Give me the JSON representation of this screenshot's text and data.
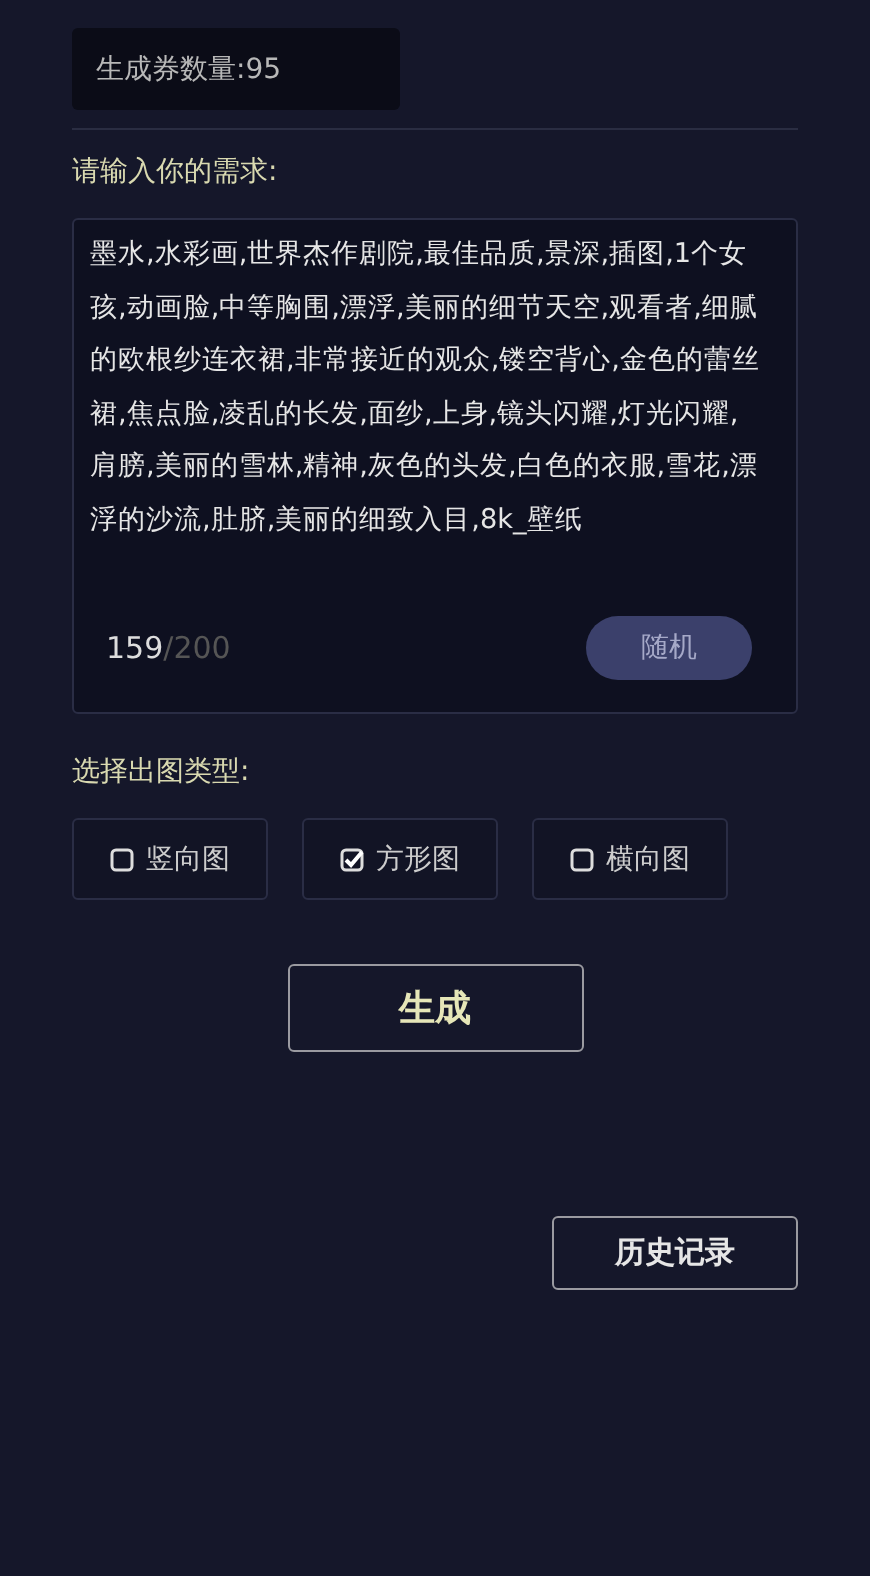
{
  "quota": {
    "text": "生成券数量:95"
  },
  "prompt": {
    "label": "请输入你的需求:",
    "value": "墨水,水彩画,世界杰作剧院,最佳品质,景深,插图,1个女孩,动画脸,中等胸围,漂浮,美丽的细节天空,观看者,细腻的欧根纱连衣裙,非常接近的观众,镂空背心,金色的蕾丝裙,焦点脸,凌乱的长发,面纱,上身,镜头闪耀,灯光闪耀,肩膀,美丽的雪林,精神,灰色的头发,白色的衣服,雪花,漂浮的沙流,肚脐,美丽的细致入目,8k_壁纸",
    "count": "159",
    "max": "/200",
    "random_button": "随机"
  },
  "type_section": {
    "label": "选择出图类型:",
    "options": [
      {
        "label": "竖向图",
        "checked": false
      },
      {
        "label": "方形图",
        "checked": true
      },
      {
        "label": "横向图",
        "checked": false
      }
    ]
  },
  "generate_button": "生成",
  "history_button": "历史记录"
}
